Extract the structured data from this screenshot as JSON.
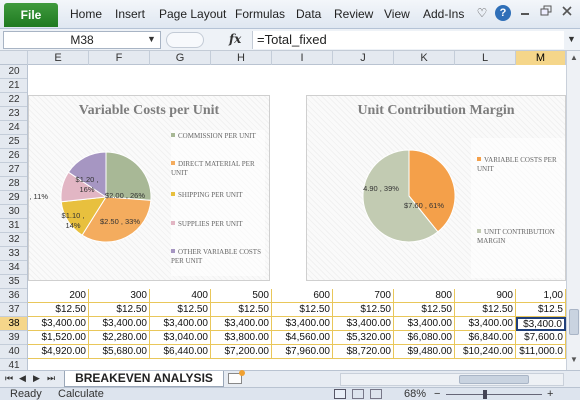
{
  "ribbon": {
    "file_label": "File",
    "tabs": [
      "Home",
      "Insert",
      "Page Layout",
      "Formulas",
      "Data",
      "Review",
      "View",
      "Add-Ins"
    ],
    "file_color": "#2a8a2a",
    "icons": [
      "heart-icon",
      "help-icon",
      "minimize-icon",
      "restore-icon",
      "close-icon"
    ],
    "help_glyph": "?"
  },
  "formula_bar": {
    "name_box": "M38",
    "fx": "fx",
    "formula": "=Total_fixed"
  },
  "grid": {
    "columns": [
      "E",
      "F",
      "G",
      "H",
      "I",
      "J",
      "K",
      "L",
      "M"
    ],
    "active_column": "M",
    "rows": [
      "20",
      "21",
      "22",
      "23",
      "24",
      "25",
      "26",
      "27",
      "28",
      "29",
      "30",
      "31",
      "32",
      "33",
      "34",
      "35",
      "36",
      "37",
      "38",
      "39",
      "40",
      "41"
    ],
    "active_row": "38",
    "header_highlight_color": "#f5d68a",
    "border_color": "#e9c75a"
  },
  "table": {
    "rows": [
      [
        "200",
        "300",
        "400",
        "500",
        "600",
        "700",
        "800",
        "900",
        "1,00"
      ],
      [
        "$12.50",
        "$12.50",
        "$12.50",
        "$12.50",
        "$12.50",
        "$12.50",
        "$12.50",
        "$12.50",
        "$12.5"
      ],
      [
        "$3,400.00",
        "$3,400.00",
        "$3,400.00",
        "$3,400.00",
        "$3,400.00",
        "$3,400.00",
        "$3,400.00",
        "$3,400.00",
        "$3,400.0"
      ],
      [
        "$1,520.00",
        "$2,280.00",
        "$3,040.00",
        "$3,800.00",
        "$4,560.00",
        "$5,320.00",
        "$6,080.00",
        "$6,840.00",
        "$7,600.0"
      ],
      [
        "$4,920.00",
        "$5,680.00",
        "$6,440.00",
        "$7,200.00",
        "$7,960.00",
        "$8,720.00",
        "$9,480.00",
        "$10,240.00",
        "$11,000.0"
      ]
    ]
  },
  "charts": {
    "variable": {
      "title": "Variable Costs per Unit",
      "legend": [
        "COMMISSION PER UNIT",
        "DIRECT MATERIAL PER UNIT",
        "SHIPPING PER UNIT",
        "SUPPLIES PER UNIT",
        "OTHER VARIABLE COSTS PER UNIT"
      ]
    },
    "contribution": {
      "title": "Unit Contribution Margin",
      "legend": [
        "VARIABLE COSTS PER UNIT",
        "UNIT CONTRIBUTION MARGIN"
      ]
    }
  },
  "chart_data": [
    {
      "type": "pie",
      "title": "Variable Costs per Unit",
      "series": [
        {
          "name": "COMMISSION PER UNIT",
          "value": 2.0,
          "percent": 26,
          "label": "$2.00 , 26%",
          "color": "#a8b896"
        },
        {
          "name": "DIRECT MATERIAL PER UNIT",
          "value": 2.5,
          "percent": 33,
          "label": "$2.50 , 33%",
          "color": "#f4ac5e"
        },
        {
          "name": "SHIPPING PER UNIT",
          "value": 1.1,
          "percent": 14,
          "label_line1": "$1.10 ,",
          "label_line2": "14%",
          "color": "#e8c03e"
        },
        {
          "name": "SUPPLIES PER UNIT",
          "value": 0.84,
          "percent": 11,
          "label": ", 11%",
          "color": "#e2b6c4"
        },
        {
          "name": "OTHER VARIABLE COSTS PER UNIT",
          "value": 1.2,
          "percent": 16,
          "label_line1": "$1.20 ,",
          "label_line2": "16%",
          "color": "#a696c2"
        }
      ]
    },
    {
      "type": "pie",
      "title": "Unit Contribution Margin",
      "series": [
        {
          "name": "VARIABLE COSTS PER UNIT",
          "value": 4.9,
          "percent": 39,
          "label": "4.90 , 39%",
          "color": "#f4a04a"
        },
        {
          "name": "UNIT CONTRIBUTION MARGIN",
          "value": 7.6,
          "percent": 61,
          "label": "$7.60 , 61%",
          "color": "#c2cbb2"
        }
      ]
    }
  ],
  "tabs": {
    "sheet_name": "BREAKEVEN ANALYSIS",
    "nav": [
      "⏮",
      "◀",
      "▶",
      "⏭"
    ]
  },
  "status": {
    "ready": "Ready",
    "calculate": "Calculate",
    "zoom": "68%",
    "minus": "−",
    "plus": "+"
  }
}
